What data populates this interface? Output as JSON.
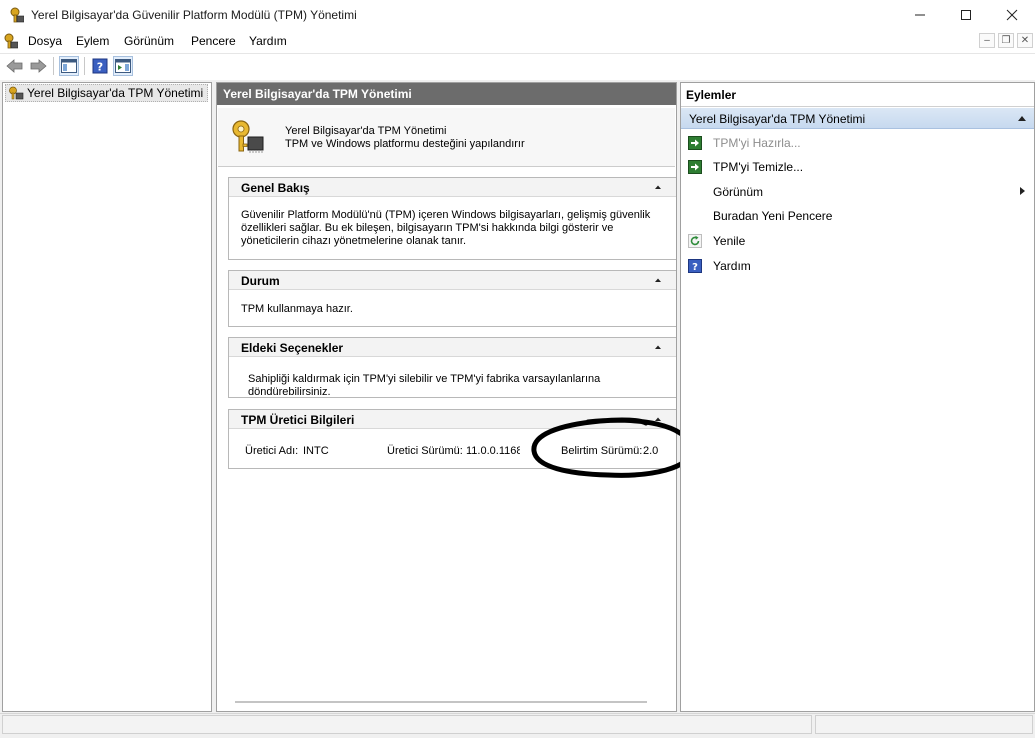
{
  "window": {
    "title": "Yerel Bilgisayar'da Güvenilir Platform Modülü (TPM) Yönetimi"
  },
  "menu": {
    "items": [
      "Dosya",
      "Eylem",
      "Görünüm",
      "Pencere",
      "Yardım"
    ]
  },
  "tree": {
    "root_label": "Yerel Bilgisayar'da TPM Yönetimi"
  },
  "center": {
    "header": "Yerel Bilgisayar'da TPM Yönetimi",
    "info_title": "Yerel Bilgisayar'da TPM Yönetimi",
    "info_subtitle": "TPM ve Windows platformu desteğini yapılandırır",
    "sections": {
      "overview": {
        "title": "Genel Bakış",
        "text": "Güvenilir Platform Modülü'nü (TPM) içeren Windows bilgisayarları, gelişmiş güvenlik özellikleri sağlar. Bu ek bileşen, bilgisayarın TPM'si hakkında bilgi gösterir ve yöneticilerin cihazı yönetmelerine olanak tanır."
      },
      "status": {
        "title": "Durum",
        "text": "TPM kullanmaya hazır."
      },
      "options": {
        "title": "Eldeki Seçenekler",
        "text": "Sahipliği kaldırmak için TPM'yi silebilir ve TPM'yi fabrika varsayılanlarına döndürebilirsiniz."
      },
      "manufacturer": {
        "title": "TPM Üretici Bilgileri",
        "name_label": "Üretici Adı:",
        "name_value": "INTC",
        "version_label": "Üretici Sürümü:",
        "version_value": "11.0.0.1168",
        "spec_label": "Belirtim Sürümü:",
        "spec_value": "2.0"
      }
    }
  },
  "actions": {
    "title": "Eylemler",
    "group_label": "Yerel Bilgisayar'da TPM Yönetimi",
    "items": [
      {
        "label": "TPM'yi Hazırla...",
        "icon": "green-arrow-icon",
        "disabled": true
      },
      {
        "label": "TPM'yi Temizle...",
        "icon": "green-arrow-icon",
        "disabled": false
      },
      {
        "label": "Görünüm",
        "icon": "",
        "disabled": false
      },
      {
        "label": "Buradan Yeni Pencere",
        "icon": "",
        "disabled": false
      },
      {
        "label": "Yenile",
        "icon": "refresh-icon",
        "disabled": false
      },
      {
        "label": "Yardım",
        "icon": "help-icon",
        "disabled": false
      }
    ]
  },
  "colors": {
    "header_gray": "#6c6c6c",
    "selection_blue": "#c7d9ef",
    "annotation": "#000000"
  }
}
